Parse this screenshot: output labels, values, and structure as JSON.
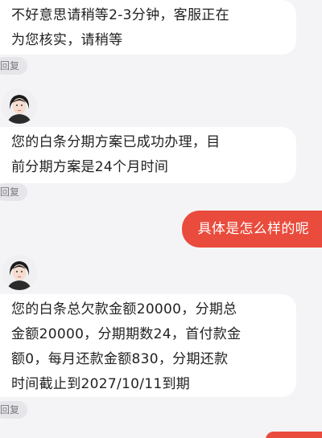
{
  "reply_label": "回复",
  "messages": [
    {
      "side": "left",
      "lines": [
        "不好意思请稍等2-3分钟，客服正在",
        "为您核实，请稍等"
      ]
    },
    {
      "side": "left",
      "lines": [
        "您的白条分期方案已成功办理，目",
        "前分期方案是24个月时间"
      ]
    },
    {
      "side": "right",
      "text": "具体是怎么样的呢"
    },
    {
      "side": "left",
      "lines": [
        "您的白条总欠款金额20000，分期总",
        "金额20000，分期期数24，首付款金",
        "额0，每月还款金额830，分期还款",
        "时间截止到2027/10/11到期"
      ]
    }
  ],
  "colors": {
    "accent": "#e94b3c",
    "background": "#f4f4f6",
    "bubble_left": "#ffffff"
  }
}
